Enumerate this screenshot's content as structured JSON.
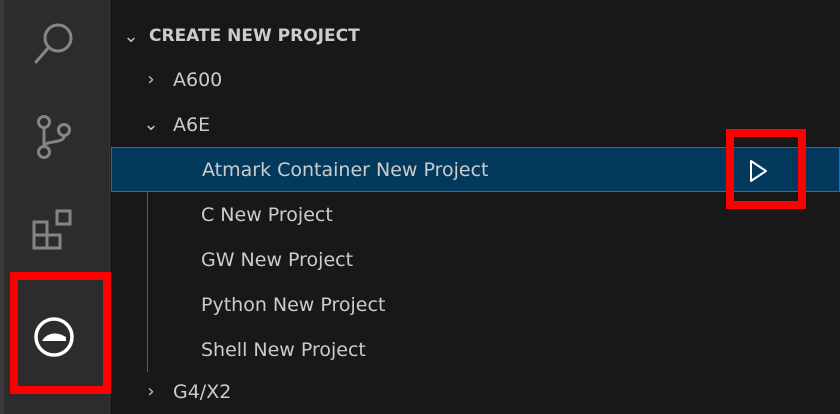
{
  "activity_bar": {
    "icons": [
      "search-icon",
      "source-control-icon",
      "extensions-icon",
      "atmark-extension-icon"
    ],
    "active": "atmark-extension-icon"
  },
  "explorer": {
    "section_title": "CREATE NEW PROJECT",
    "tree": [
      {
        "label": "A600",
        "expanded": false
      },
      {
        "label": "A6E",
        "expanded": true,
        "children": [
          "Atmark Container New Project",
          "C New Project",
          "GW New Project",
          "Python New Project",
          "Shell New Project"
        ]
      },
      {
        "label": "G4/X2",
        "expanded": false
      }
    ],
    "selected_item": "Atmark Container New Project",
    "run_action_icon": "play-icon"
  },
  "colors": {
    "highlight_box": "#ff0000",
    "selection_bg": "#04395e",
    "selection_border": "#0078d4"
  }
}
